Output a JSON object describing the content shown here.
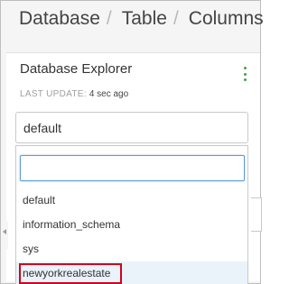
{
  "breadcrumb": {
    "items": [
      "Database",
      "Table",
      "Columns"
    ],
    "separator": "/"
  },
  "card": {
    "title": "Database Explorer",
    "last_update_label": "LAST UPDATE:",
    "last_update_value": "4 sec ago",
    "menu_icon": "kebab-vertical-icon",
    "accent_color": "#43a047"
  },
  "database_select": {
    "selected": "default"
  },
  "dropdown": {
    "search_value": "",
    "options": [
      "default",
      "information_schema",
      "sys",
      "newyorkrealestate"
    ],
    "highlighted_option": "newyorkrealestate",
    "highlight_color": "#d0021b"
  }
}
